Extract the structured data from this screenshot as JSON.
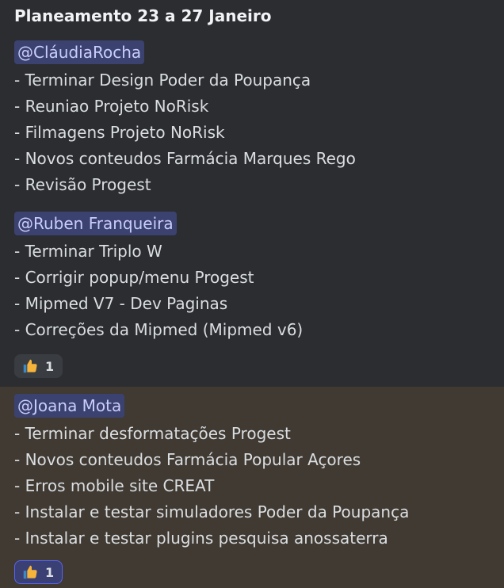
{
  "sections": {
    "title": "Planeamento 23 a 27 Janeiro",
    "claudia": {
      "mention": "@CláudiaRocha",
      "items": [
        "- Terminar Design Poder da Poupança",
        "- Reuniao Projeto NoRisk",
        "- Filmagens Projeto NoRisk",
        "- Novos conteudos Farmácia Marques Rego",
        "- Revisão Progest"
      ]
    },
    "ruben": {
      "mention": "@Ruben Franqueira",
      "items": [
        "- Terminar Triplo W",
        "- Corrigir popup/menu Progest",
        "- Mipmed V7 - Dev Paginas",
        "- Correções da Mipmed (Mipmed v6)"
      ],
      "reaction": {
        "icon": "thumbs-up-icon",
        "count": "1"
      }
    },
    "joana": {
      "mention": "@Joana Mota",
      "items": [
        "- Terminar desformatações Progest",
        "- Novos conteudos Farmácia Popular Açores",
        "- Erros mobile site CREAT",
        "- Instalar e testar simuladores Poder da Poupança",
        "- Instalar e testar plugins pesquisa anossaterra"
      ],
      "reaction": {
        "icon": "thumbs-up-icon",
        "count": "1"
      }
    }
  },
  "colors": {
    "background": "#2b2d31",
    "highlight": "#403a33",
    "mention_bg": "#3c4270",
    "mention_text": "#c9cdfb",
    "reaction_active_border": "#5865f2"
  }
}
